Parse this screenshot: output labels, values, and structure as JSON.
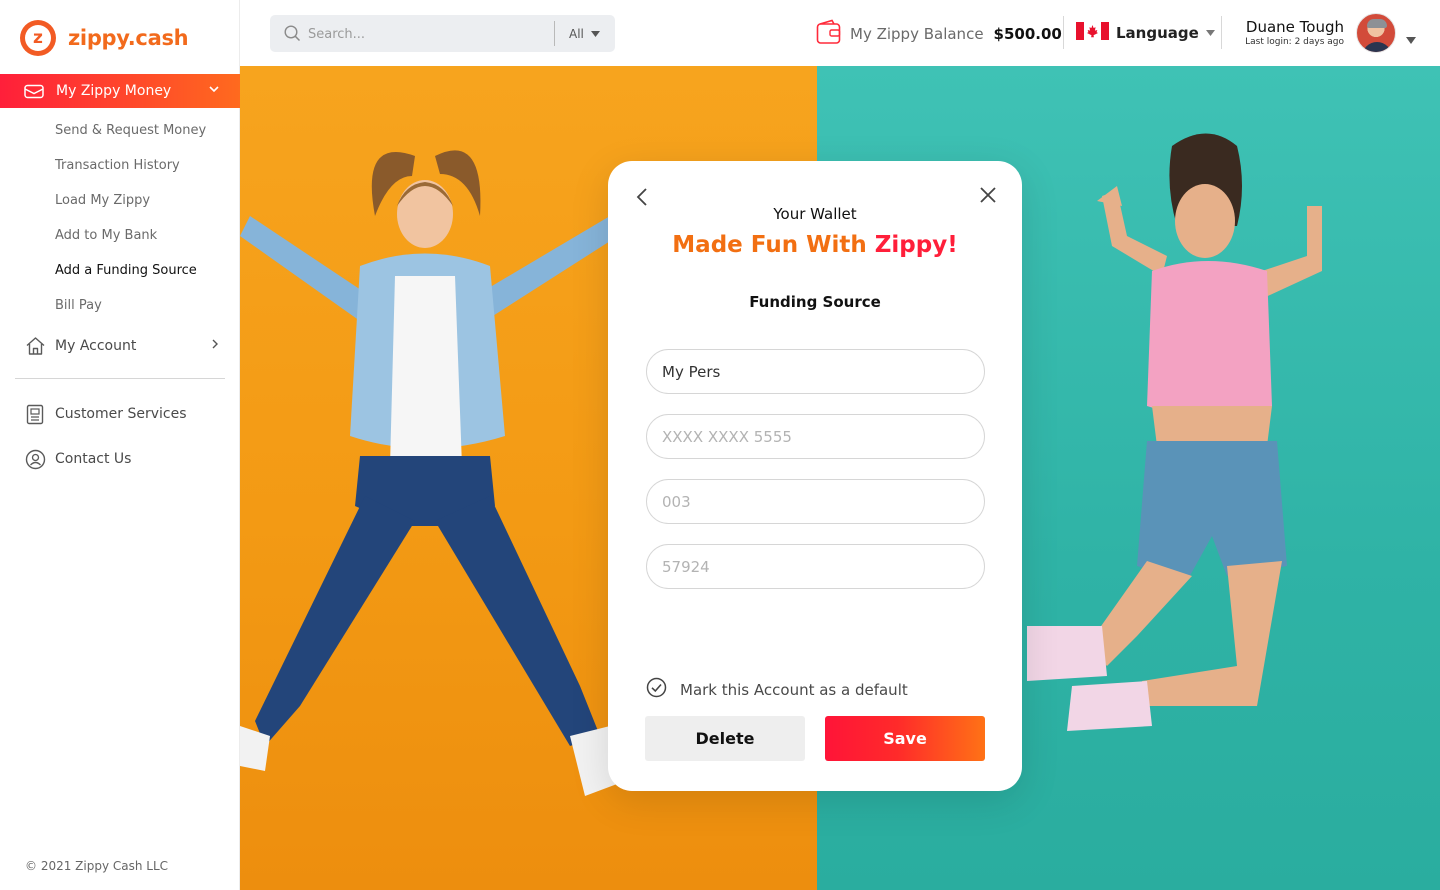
{
  "brand": {
    "name": "zippy.cash",
    "mark": "z",
    "color": "#f26a1c"
  },
  "sidebar": {
    "active_section": {
      "label": "My Zippy Money",
      "icon": "wallet-icon"
    },
    "sub_items": [
      {
        "label": "Send & Request Money"
      },
      {
        "label": "Transaction History"
      },
      {
        "label": "Load My Zippy"
      },
      {
        "label": "Add to My Bank"
      },
      {
        "label": "Add a Funding Source",
        "active": true
      },
      {
        "label": "Bill Pay"
      }
    ],
    "my_account": {
      "label": "My Account",
      "icon": "home-icon"
    },
    "customer_services": {
      "label": "Customer Services",
      "icon": "document-icon"
    },
    "contact_us": {
      "label": "Contact Us",
      "icon": "user-circle-icon"
    },
    "footer": "© 2021 Zippy Cash LLC"
  },
  "header": {
    "search": {
      "placeholder": "Search...",
      "filter": "All"
    },
    "balance": {
      "label": "My Zippy Balance",
      "amount": "$500.00",
      "icon": "wallet-icon"
    },
    "language": {
      "label": "Language",
      "flag": "canada-flag-icon"
    },
    "user": {
      "name": "Duane Tough",
      "last_login": "Last login: 2 days ago"
    }
  },
  "modal": {
    "subtitle": "Your Wallet",
    "title_part1": "Made Fun With ",
    "title_part2": "Zippy!",
    "section": "Funding Source",
    "fields": {
      "account_name": {
        "value": "My Pers"
      },
      "account_number": {
        "placeholder": "XXXX XXXX 5555"
      },
      "institution": {
        "placeholder": "003"
      },
      "transit": {
        "placeholder": "57924"
      }
    },
    "default_checkbox": {
      "label": "Mark this Account as a default",
      "checked": true
    },
    "delete_label": "Delete",
    "save_label": "Save"
  },
  "colors": {
    "accent_red": "#ff1f3a",
    "accent_orange": "#f26f12",
    "hero_left": "#f7a41e",
    "hero_right": "#3fc2b5"
  }
}
